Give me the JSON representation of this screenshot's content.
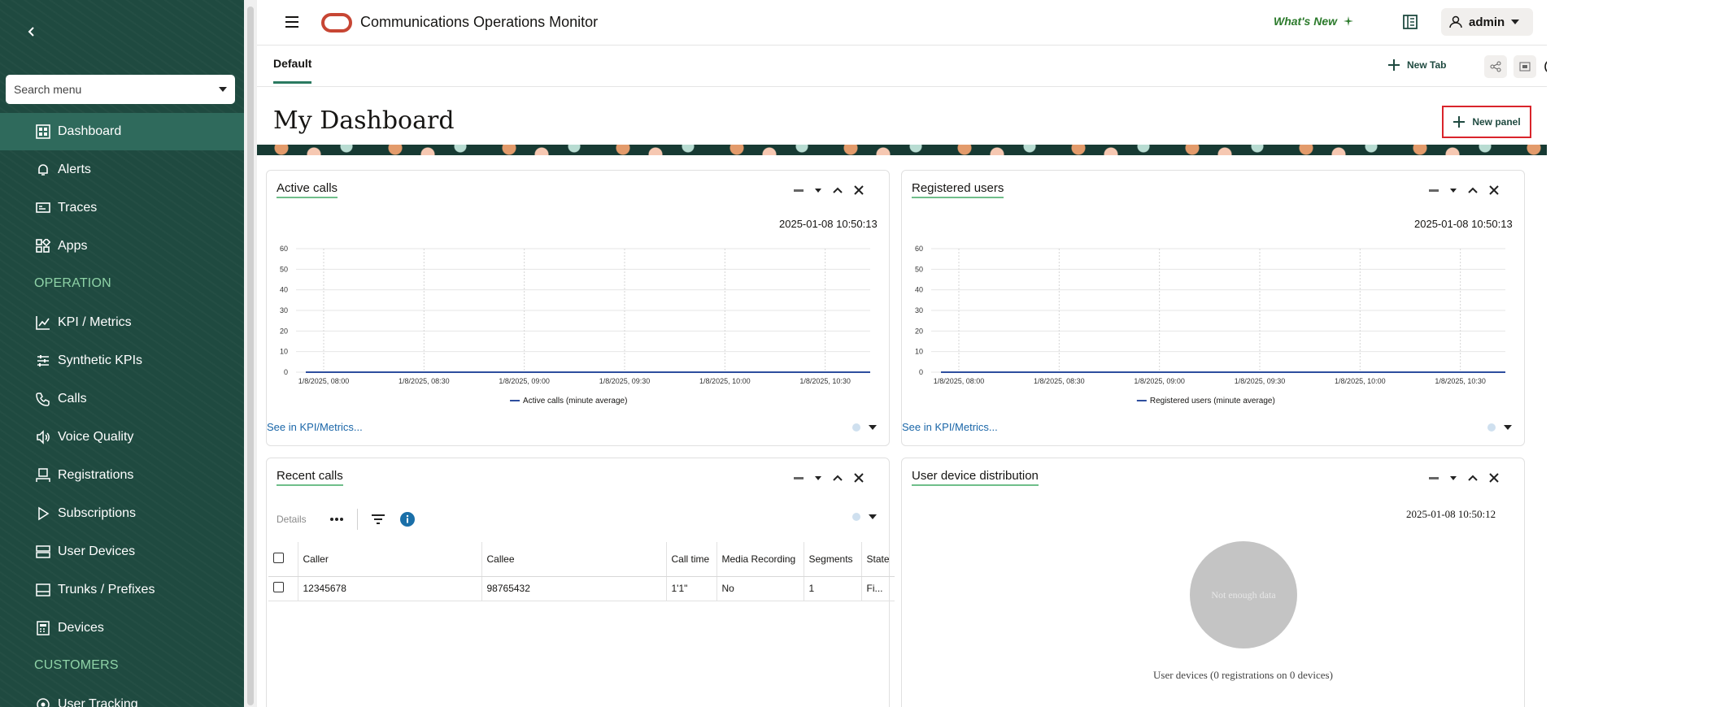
{
  "sidebar": {
    "search_placeholder": "Search menu",
    "items": [
      {
        "label": "Dashboard",
        "icon": "dashboard-icon"
      },
      {
        "label": "Alerts",
        "icon": "bell-icon"
      },
      {
        "label": "Traces",
        "icon": "traces-icon"
      },
      {
        "label": "Apps",
        "icon": "apps-icon"
      },
      {
        "label": "KPI / Metrics",
        "icon": "chart-line-icon"
      },
      {
        "label": "Synthetic KPIs",
        "icon": "sliders-icon"
      },
      {
        "label": "Calls",
        "icon": "phone-icon"
      },
      {
        "label": "Voice Quality",
        "icon": "speaker-icon"
      },
      {
        "label": "Registrations",
        "icon": "person-badge-icon"
      },
      {
        "label": "Subscriptions",
        "icon": "play-icon"
      },
      {
        "label": "User Devices",
        "icon": "server-icon"
      },
      {
        "label": "Trunks / Prefixes",
        "icon": "window-icon"
      },
      {
        "label": "Devices",
        "icon": "calculator-icon"
      },
      {
        "label": "User Tracking",
        "icon": "target-icon"
      }
    ],
    "sections": {
      "operation": "OPERATION",
      "customers": "CUSTOMERS"
    }
  },
  "header": {
    "title": "Communications Operations Monitor",
    "whats_new": "What's New",
    "user": "admin"
  },
  "tabs": {
    "default": "Default",
    "new_tab": "New Tab"
  },
  "dashboard": {
    "title": "My Dashboard",
    "new_panel": "New panel"
  },
  "panels": {
    "active_calls": {
      "title": "Active calls",
      "timestamp": "2025-01-08 10:50:13",
      "link": "See in KPI/Metrics...",
      "legend": "Active calls (minute average)"
    },
    "registered_users": {
      "title": "Registered users",
      "timestamp": "2025-01-08 10:50:13",
      "link": "See in KPI/Metrics...",
      "legend": "Registered users (minute average)"
    },
    "recent_calls": {
      "title": "Recent calls",
      "details": "Details",
      "columns": [
        "Caller",
        "Callee",
        "Call time",
        "Media Recording",
        "Segments",
        "State"
      ],
      "rows": [
        {
          "caller": "12345678",
          "callee": "98765432",
          "call_time": "1'1\"",
          "media_recording": "No",
          "segments": "1",
          "state": "Fi..."
        }
      ]
    },
    "user_device_distribution": {
      "title": "User device distribution",
      "timestamp": "2025-01-08 10:50:12",
      "empty": "Not enough data",
      "caption": "User devices (0 registrations on 0 devices)"
    }
  },
  "chart_data": [
    {
      "type": "line",
      "x": [
        "1/8/2025, 08:00",
        "1/8/2025, 08:30",
        "1/8/2025, 09:00",
        "1/8/2025, 09:30",
        "1/8/2025, 10:00",
        "1/8/2025, 10:30"
      ],
      "yticks": [
        0,
        10,
        20,
        30,
        40,
        50,
        60
      ],
      "ylim": [
        0,
        60
      ],
      "series": [
        {
          "name": "Active calls (minute average)",
          "values": [
            0,
            0,
            0,
            0,
            0,
            0
          ],
          "color": "#2e4e9e"
        }
      ],
      "legend": "bottom",
      "grid": true
    },
    {
      "type": "line",
      "x": [
        "1/8/2025, 08:00",
        "1/8/2025, 08:30",
        "1/8/2025, 09:00",
        "1/8/2025, 09:30",
        "1/8/2025, 10:00",
        "1/8/2025, 10:30"
      ],
      "yticks": [
        0,
        10,
        20,
        30,
        40,
        50,
        60
      ],
      "ylim": [
        0,
        60
      ],
      "series": [
        {
          "name": "Registered users (minute average)",
          "values": [
            0,
            0,
            0,
            0,
            0,
            0
          ],
          "color": "#2e4e9e"
        }
      ],
      "legend": "bottom",
      "grid": true
    }
  ],
  "colors": {
    "sidebar_bg": "#1f4a40",
    "accent_green": "#2a7a60",
    "section_green": "#8fd3a7",
    "highlight_red": "#d9242b",
    "link_blue": "#1a66a8"
  }
}
